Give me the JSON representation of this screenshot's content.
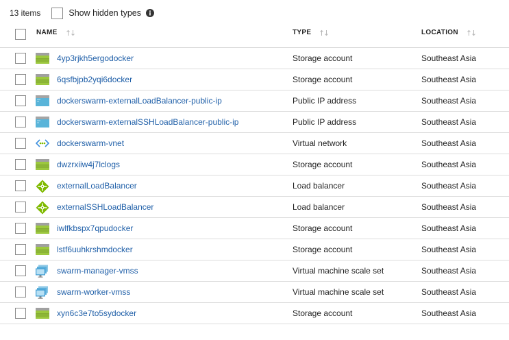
{
  "toolbar": {
    "item_count": "13 items",
    "show_hidden_label": "Show hidden types",
    "info_icon": "info-icon"
  },
  "columns": {
    "name": "NAME",
    "type": "TYPE",
    "location": "LOCATION"
  },
  "rows": [
    {
      "name": "4yp3rjkh5ergodocker",
      "type": "Storage account",
      "location": "Southeast Asia",
      "icon": "storage-account-icon"
    },
    {
      "name": "6qsfbjpb2yqi6docker",
      "type": "Storage account",
      "location": "Southeast Asia",
      "icon": "storage-account-icon"
    },
    {
      "name": "dockerswarm-externalLoadBalancer-public-ip",
      "type": "Public IP address",
      "location": "Southeast Asia",
      "icon": "public-ip-icon"
    },
    {
      "name": "dockerswarm-externalSSHLoadBalancer-public-ip",
      "type": "Public IP address",
      "location": "Southeast Asia",
      "icon": "public-ip-icon"
    },
    {
      "name": "dockerswarm-vnet",
      "type": "Virtual network",
      "location": "Southeast Asia",
      "icon": "virtual-network-icon"
    },
    {
      "name": "dwzrxiiw4j7lclogs",
      "type": "Storage account",
      "location": "Southeast Asia",
      "icon": "storage-account-icon"
    },
    {
      "name": "externalLoadBalancer",
      "type": "Load balancer",
      "location": "Southeast Asia",
      "icon": "load-balancer-icon"
    },
    {
      "name": "externalSSHLoadBalancer",
      "type": "Load balancer",
      "location": "Southeast Asia",
      "icon": "load-balancer-icon"
    },
    {
      "name": "iwlfkbspx7qpudocker",
      "type": "Storage account",
      "location": "Southeast Asia",
      "icon": "storage-account-icon"
    },
    {
      "name": "lstf6uuhkrshmdocker",
      "type": "Storage account",
      "location": "Southeast Asia",
      "icon": "storage-account-icon"
    },
    {
      "name": "swarm-manager-vmss",
      "type": "Virtual machine scale set",
      "location": "Southeast Asia",
      "icon": "vm-scale-set-icon"
    },
    {
      "name": "swarm-worker-vmss",
      "type": "Virtual machine scale set",
      "location": "Southeast Asia",
      "icon": "vm-scale-set-icon"
    },
    {
      "name": "xyn6c3e7to5sydocker",
      "type": "Storage account",
      "location": "Southeast Asia",
      "icon": "storage-account-icon"
    }
  ],
  "colors": {
    "link": "#1f5fa8",
    "storage_green": "#8fbc3c",
    "public_ip_blue": "#59b4d9",
    "load_balancer_green": "#7fba00"
  }
}
